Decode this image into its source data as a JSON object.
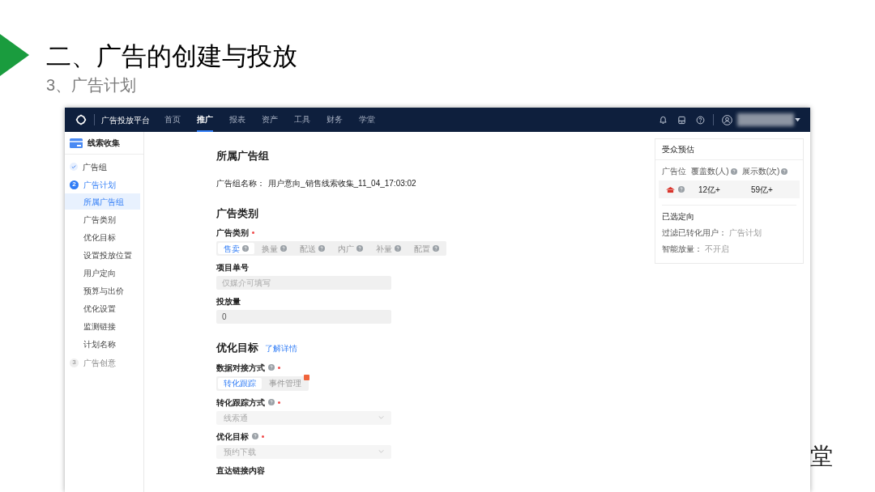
{
  "slide": {
    "title": "二、广告的创建与投放",
    "subtitle": "3、广告计划",
    "corner_text": "堂"
  },
  "top_nav": {
    "brand": "广告投放平台",
    "tabs": [
      {
        "label": "首页",
        "selected": false
      },
      {
        "label": "推广",
        "selected": true
      },
      {
        "label": "报表",
        "selected": false
      },
      {
        "label": "资产",
        "selected": false
      },
      {
        "label": "工具",
        "selected": false
      },
      {
        "label": "财务",
        "selected": false
      },
      {
        "label": "学堂",
        "selected": false
      }
    ]
  },
  "sidebar": {
    "header": "线索收集",
    "steps": [
      {
        "label": "广告组",
        "kind": "done"
      },
      {
        "number": "2",
        "label": "广告计划",
        "kind": "current",
        "children": [
          {
            "label": "所属广告组",
            "selected": true
          },
          {
            "label": "广告类别",
            "selected": false
          },
          {
            "label": "优化目标",
            "selected": false
          },
          {
            "label": "设置投放位置",
            "selected": false
          },
          {
            "label": "用户定向",
            "selected": false
          },
          {
            "label": "预算与出价",
            "selected": false
          },
          {
            "label": "优化设置",
            "selected": false
          },
          {
            "label": "监测链接",
            "selected": false
          },
          {
            "label": "计划名称",
            "selected": false
          }
        ]
      },
      {
        "number": "3",
        "label": "广告创意",
        "kind": "upcoming"
      }
    ]
  },
  "form": {
    "sections": [
      {
        "heading": "所属广告组",
        "fields": [
          {
            "kind": "info",
            "label": "广告组名称：",
            "value": "用户意向_销售线索收集_11_04_17:03:02"
          }
        ]
      },
      {
        "heading": "广告类别",
        "fields": [
          {
            "kind": "segmented",
            "label": "广告类别",
            "required": true,
            "help": false,
            "options": [
              {
                "label": "售卖",
                "selected": true,
                "help": true,
                "badge": false
              },
              {
                "label": "换量",
                "selected": false,
                "help": true,
                "badge": false
              },
              {
                "label": "配送",
                "selected": false,
                "help": true,
                "badge": false
              },
              {
                "label": "内广",
                "selected": false,
                "help": true,
                "badge": false
              },
              {
                "label": "补量",
                "selected": false,
                "help": true,
                "badge": false
              },
              {
                "label": "配置",
                "selected": false,
                "help": true,
                "badge": false
              }
            ]
          },
          {
            "kind": "input",
            "label": "项目单号",
            "required": false,
            "help": false,
            "placeholder": "仅媒介可填写",
            "disabled": true
          },
          {
            "kind": "input",
            "label": "投放量",
            "required": false,
            "help": false,
            "value": "0",
            "disabled": true
          }
        ]
      },
      {
        "heading": "优化目标",
        "link": "了解详情",
        "fields": [
          {
            "kind": "segmented",
            "label": "数据对接方式",
            "required": true,
            "help": true,
            "options": [
              {
                "label": "转化跟踪",
                "selected": true,
                "help": false,
                "badge": false
              },
              {
                "label": "事件管理",
                "selected": false,
                "help": false,
                "badge": true
              }
            ]
          },
          {
            "kind": "select",
            "label": "转化跟踪方式",
            "required": true,
            "help": true,
            "value": "线索通",
            "disabled": true
          },
          {
            "kind": "select",
            "label": "优化目标",
            "required": true,
            "help": true,
            "value": "预约下载",
            "disabled": true
          },
          {
            "kind": "label",
            "label": "直达链接内容",
            "required": false,
            "help": false
          }
        ]
      }
    ]
  },
  "audience_card": {
    "title": "受众预估",
    "columns": [
      {
        "label": "广告位",
        "help": false
      },
      {
        "label": "覆盖数(人)",
        "help": true
      },
      {
        "label": "展示数(次)",
        "help": true
      }
    ],
    "row": {
      "help": true,
      "coverage": "12亿+",
      "impressions": "59亿+"
    },
    "targeting_title": "已选定向",
    "targeting": [
      {
        "label": "过滤已转化用户：",
        "value": "广告计划"
      },
      {
        "label": "智能放量：",
        "value": "不开启"
      }
    ]
  }
}
